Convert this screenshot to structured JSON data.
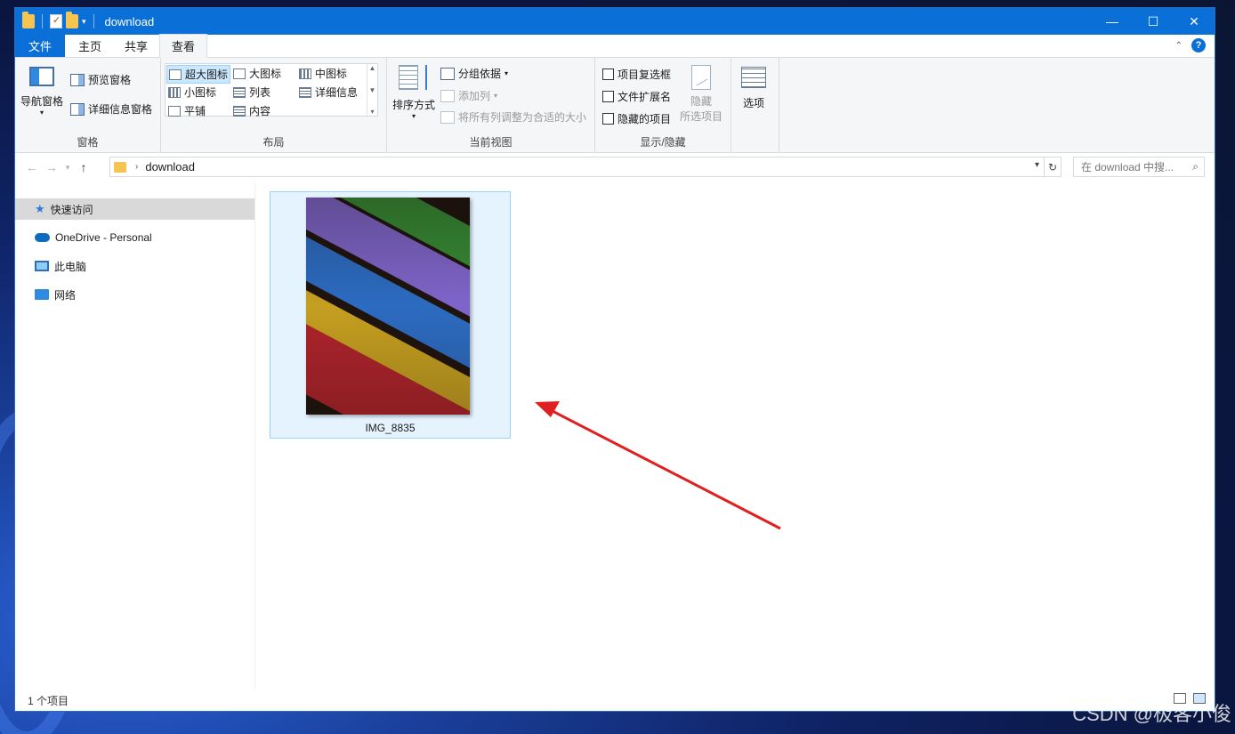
{
  "window": {
    "title": "download",
    "controls": {
      "minimize": "—",
      "maximize": "☐",
      "close": "✕"
    }
  },
  "tabs": [
    {
      "label": "文件"
    },
    {
      "label": "主页"
    },
    {
      "label": "共享"
    },
    {
      "label": "查看"
    }
  ],
  "ribbon": {
    "panes": {
      "nav_pane": "导航窗格",
      "preview_pane": "预览窗格",
      "details_pane": "详细信息窗格",
      "label": "窗格"
    },
    "layout": {
      "items": [
        "超大图标",
        "大图标",
        "中图标",
        "小图标",
        "列表",
        "详细信息",
        "平铺",
        "内容"
      ],
      "label": "布局"
    },
    "current_view": {
      "sort_by": "排序方式",
      "group_by": "分组依据",
      "add_columns": "添加列",
      "size_all_columns": "将所有列调整为合适的大小",
      "label": "当前视图"
    },
    "show_hide": {
      "item_checkboxes": "项目复选框",
      "file_extensions": "文件扩展名",
      "hidden_items": "隐藏的项目",
      "hide_selected_line1": "隐藏",
      "hide_selected_line2": "所选项目",
      "label": "显示/隐藏"
    },
    "options": {
      "label": "选项"
    }
  },
  "address": {
    "path": "download",
    "search_placeholder": "在 download 中搜..."
  },
  "nav": {
    "items": [
      "快速访问",
      "OneDrive - Personal",
      "此电脑",
      "网络"
    ]
  },
  "files": [
    {
      "name": "IMG_8835"
    }
  ],
  "status": {
    "count": "1 个项目"
  },
  "watermark": "CSDN @极客小俊"
}
